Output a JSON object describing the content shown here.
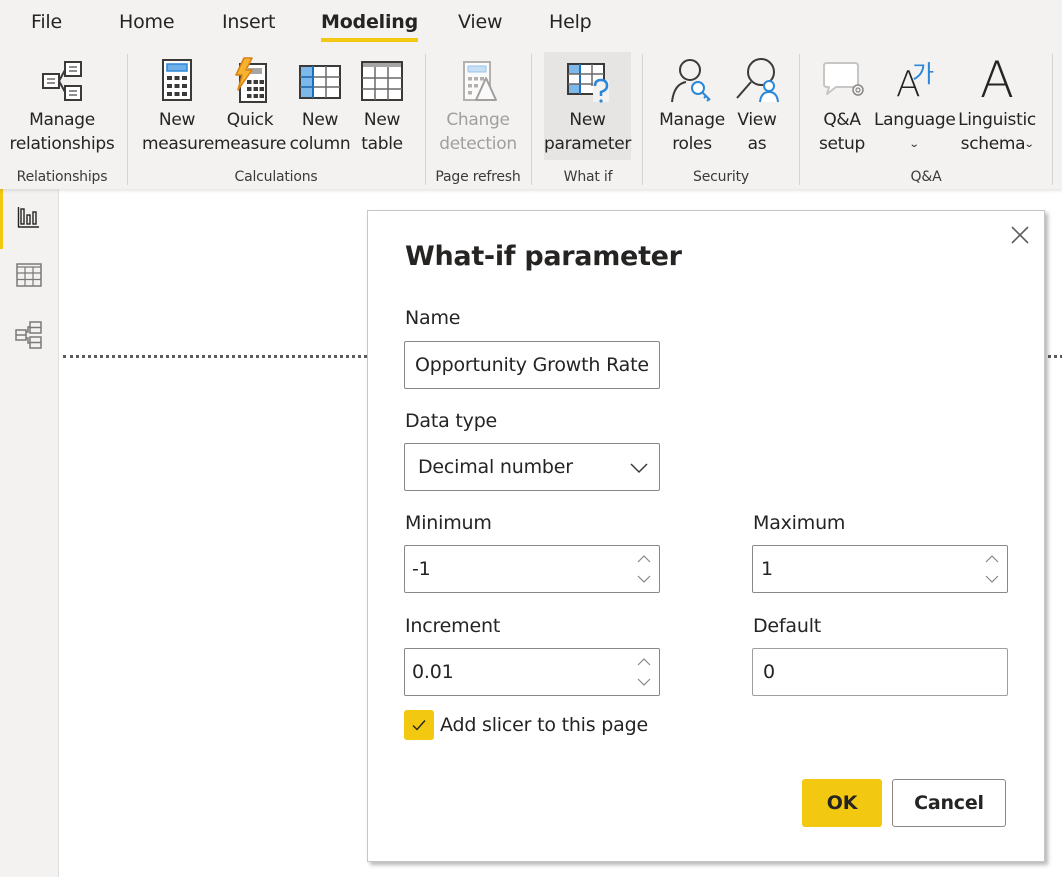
{
  "tabs": [
    {
      "label": "File",
      "active": false
    },
    {
      "label": "Home",
      "active": false
    },
    {
      "label": "Insert",
      "active": false
    },
    {
      "label": "Modeling",
      "active": true
    },
    {
      "label": "View",
      "active": false
    },
    {
      "label": "Help",
      "active": false
    }
  ],
  "ribbon": {
    "groups": {
      "relationships": "Relationships",
      "calculations": "Calculations",
      "page_refresh": "Page refresh",
      "what_if": "What if",
      "security": "Security",
      "qa": "Q&A"
    },
    "buttons": {
      "manage_relationships": {
        "line1": "Manage",
        "line2": "relationships",
        "icon": "relationships-icon"
      },
      "new_measure": {
        "line1": "New",
        "line2": "measure",
        "icon": "calculator-icon"
      },
      "quick_measure": {
        "line1": "Quick",
        "line2": "measure",
        "icon": "quick-measure-icon"
      },
      "new_column": {
        "line1": "New",
        "line2": "column",
        "icon": "new-column-icon"
      },
      "new_table": {
        "line1": "New",
        "line2": "table",
        "icon": "new-table-icon"
      },
      "change_detection": {
        "line1": "Change",
        "line2": "detection",
        "icon": "change-detection-icon",
        "disabled": true
      },
      "new_parameter": {
        "line1": "New",
        "line2": "parameter",
        "icon": "new-parameter-icon",
        "selected": true
      },
      "manage_roles": {
        "line1": "Manage",
        "line2": "roles",
        "icon": "manage-roles-icon"
      },
      "view_as": {
        "line1": "View",
        "line2": "as",
        "icon": "view-as-icon"
      },
      "qa_setup": {
        "line1": "Q&A",
        "line2": "setup",
        "icon": "qa-setup-icon"
      },
      "language": {
        "line1": "Language",
        "line2": "",
        "icon": "language-icon",
        "dropdown": true
      },
      "linguistic_schema": {
        "line1": "Linguistic",
        "line2": "schema",
        "icon": "linguistic-schema-icon",
        "dropdown": true
      }
    },
    "language_glyph": "가",
    "linguistic_glyph": "A",
    "language_latin_glyph": "A"
  },
  "leftnav": [
    {
      "name": "report-view",
      "icon": "bar-chart-icon",
      "active": true
    },
    {
      "name": "data-view",
      "icon": "table-grid-icon",
      "active": false
    },
    {
      "name": "model-view",
      "icon": "model-icon",
      "active": false
    }
  ],
  "dialog": {
    "title": "What-if parameter",
    "name_label": "Name",
    "name_value": "Opportunity Growth Rate",
    "datatype_label": "Data type",
    "datatype_value": "Decimal number",
    "minimum_label": "Minimum",
    "minimum_value": "-1",
    "maximum_label": "Maximum",
    "maximum_value": "1",
    "increment_label": "Increment",
    "increment_value": "0.01",
    "default_label": "Default",
    "default_value": "0",
    "add_slicer_label": "Add slicer to this page",
    "add_slicer_checked": true,
    "ok_label": "OK",
    "cancel_label": "Cancel"
  },
  "colors": {
    "accent": "#f2c811",
    "ribbon_bg": "#f3f2f1",
    "icon_blue": "#2b88d8",
    "icon_light_blue": "#8cc4f0",
    "text": "#252423",
    "disabled_text": "#a19f9d"
  }
}
